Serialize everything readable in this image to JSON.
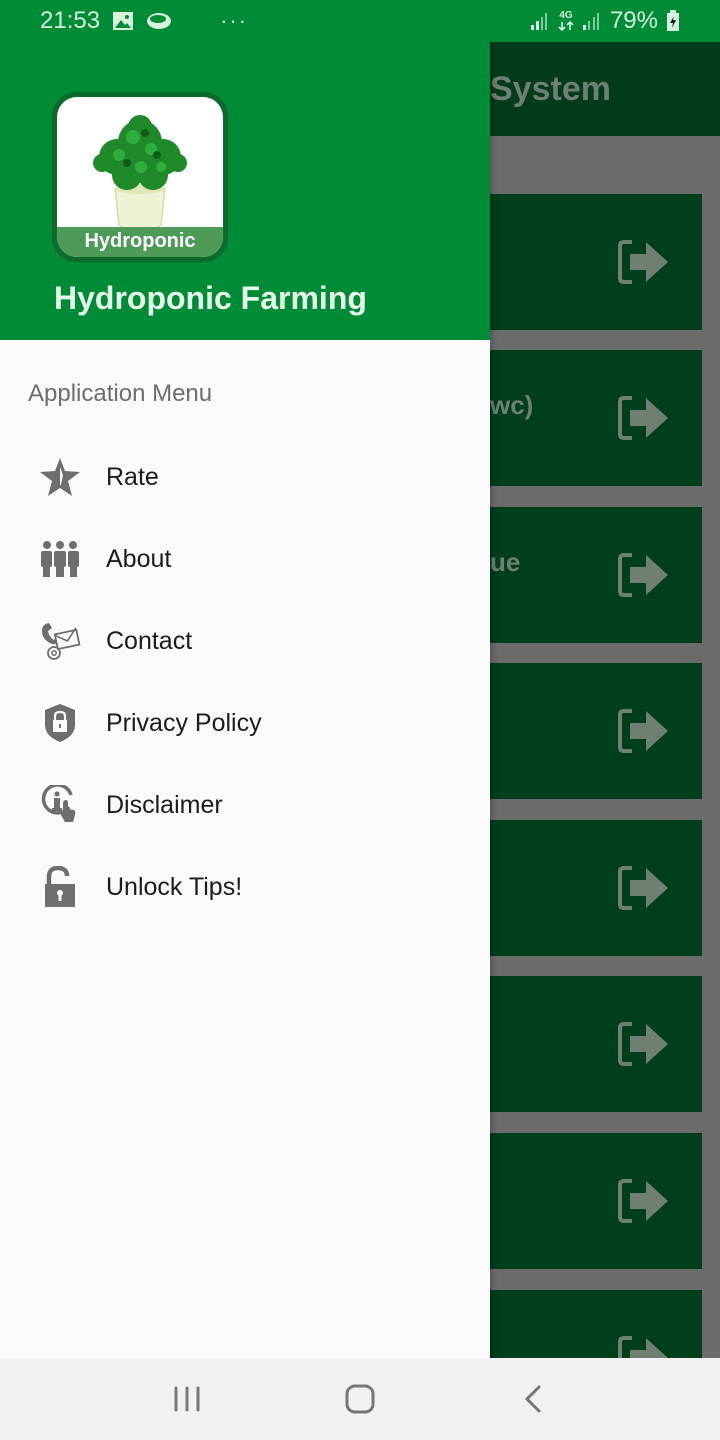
{
  "status_bar": {
    "time": "21:53",
    "notification_icons": [
      "gallery-icon",
      "cloud-icon"
    ],
    "more_indicator": "···",
    "network_label": "4G",
    "battery_percent": "79%",
    "battery_state": "charging"
  },
  "background_app": {
    "toolbar_title_fragment": "System",
    "cards": [
      {
        "label_fragment": ""
      },
      {
        "label_fragment": "wc)"
      },
      {
        "label_fragment": "ue"
      },
      {
        "label_fragment": ""
      },
      {
        "label_fragment": ""
      },
      {
        "label_fragment": ""
      },
      {
        "label_fragment": ""
      },
      {
        "label_fragment": ""
      }
    ],
    "card_icon": "open-arrow-icon"
  },
  "drawer": {
    "logo_text": "Hydroponic",
    "title": "Hydroponic Farming",
    "section_title": "Application Menu",
    "items": [
      {
        "label": "Rate",
        "icon": "star-icon"
      },
      {
        "label": "About",
        "icon": "people-icon"
      },
      {
        "label": "Contact",
        "icon": "contact-icon"
      },
      {
        "label": "Privacy Policy",
        "icon": "shield-lock-icon"
      },
      {
        "label": "Disclaimer",
        "icon": "info-touch-icon"
      },
      {
        "label": "Unlock Tips!",
        "icon": "unlock-icon"
      }
    ]
  },
  "nav_bar": {
    "buttons": [
      "recents",
      "home",
      "back"
    ]
  },
  "colors": {
    "primary_green": "#008b36",
    "dark_green_dimmed": "#013e1b",
    "drawer_bg": "#fafafa",
    "icon_gray": "#6e6e6e"
  }
}
